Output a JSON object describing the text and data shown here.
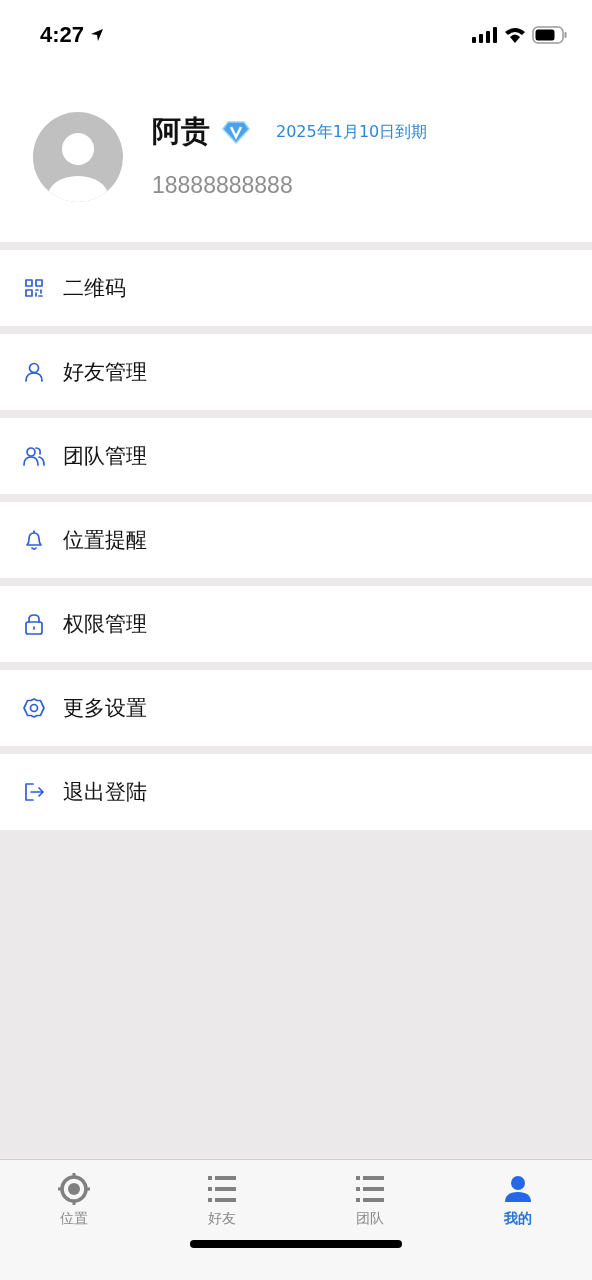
{
  "status_bar": {
    "time": "4:27"
  },
  "profile": {
    "name": "阿贵",
    "vip": true,
    "expiry": "2025年1月10日到期",
    "phone": "18888888888"
  },
  "menu": [
    {
      "kind": "qr",
      "label": "二维码"
    },
    {
      "kind": "person",
      "label": "好友管理"
    },
    {
      "kind": "people",
      "label": "团队管理"
    },
    {
      "kind": "bell",
      "label": "位置提醒"
    },
    {
      "kind": "lock",
      "label": "权限管理"
    },
    {
      "kind": "gear",
      "label": "更多设置"
    },
    {
      "kind": "logout",
      "label": "退出登陆"
    }
  ],
  "tab_bar": [
    {
      "kind": "target",
      "label": "位置",
      "selected": false
    },
    {
      "kind": "list",
      "label": "好友",
      "selected": false
    },
    {
      "kind": "list",
      "label": "团队",
      "selected": false
    },
    {
      "kind": "person",
      "label": "我的",
      "selected": true
    }
  ]
}
